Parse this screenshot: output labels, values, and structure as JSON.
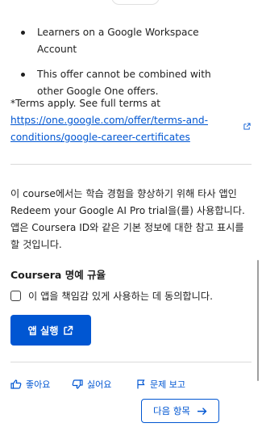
{
  "offer_notes": [
    "Learners on a Google Workspace Account",
    "This offer cannot be combined with other Google One offers."
  ],
  "terms": {
    "prefix": "*Terms apply. See full terms at",
    "link_text": "https://one.google.com/offer/terms-and-conditions/google-career-certificates"
  },
  "notice": "이 course에서는 학습 경험을 향상하기 위해 타사 앱인 Redeem your Google AI Pro trial을(를) 사용합니다. 앱은 Coursera ID와 같은 기본 정보에 대한 참고 표시를 할 것입니다.",
  "honor_code": {
    "title": "Coursera 명예 규율",
    "agree_label": "이 앱을 책임감 있게 사용하는 데 동의합니다."
  },
  "launch_button": "앱 실행",
  "feedback": {
    "like": "좋아요",
    "dislike": "싫어요",
    "report": "문제 보고"
  },
  "next_button": "다음 항목",
  "colors": {
    "accent": "#0056d2",
    "text": "#1f1f1f",
    "divider": "#dadada"
  },
  "icons": [
    "external-link-icon",
    "open-in-new-icon",
    "thumbs-up-icon",
    "thumbs-down-icon",
    "flag-icon",
    "arrow-right-icon"
  ]
}
